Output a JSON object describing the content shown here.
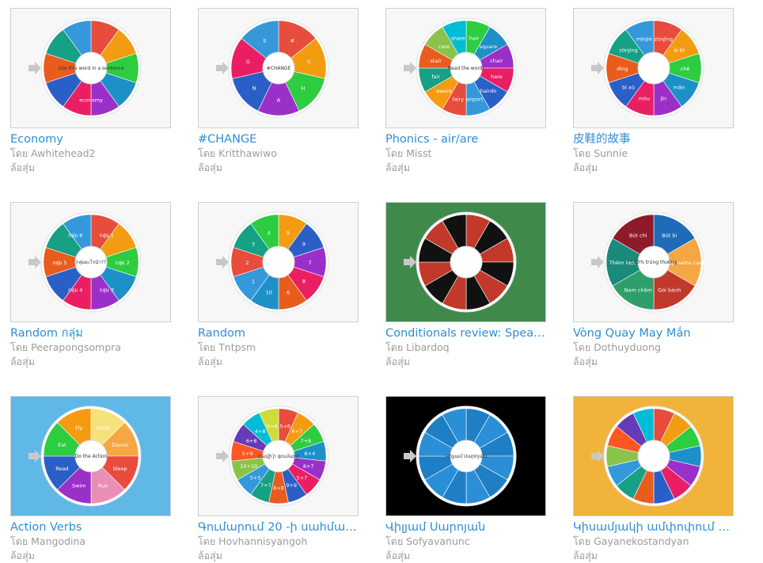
{
  "by_label": "โดย",
  "type_label": "ล้อสุ่ม",
  "activities": [
    {
      "title": "Economy",
      "author": "Awhitehead2",
      "center_text": "Use this word in a sentence",
      "segment_labels": [
        "economy"
      ],
      "background": "#f7f7f7",
      "colors": [
        "#e74c3c",
        "#f39c12",
        "#2ecc40",
        "#1e90c8",
        "#9b30c8",
        "#e91e63",
        "#2b5fc8",
        "#e85c1e",
        "#16a085",
        "#3498db"
      ]
    },
    {
      "title": "#CHANGE",
      "author": "Kritthawiwo",
      "center_text": "#CHANGE",
      "segment_labels": [
        "#",
        "C",
        "H",
        "A",
        "N",
        "G",
        "E"
      ],
      "background": "#f7f7f7",
      "colors": [
        "#e74c3c",
        "#f39c12",
        "#2ecc40",
        "#9b30c8",
        "#2b5fc8",
        "#e91e63",
        "#3498db"
      ]
    },
    {
      "title": "Phonics - air/are",
      "author": "Misst",
      "center_text": "Read the word!",
      "segment_labels": [
        "hair",
        "square",
        "chair",
        "hare",
        "hairdo",
        "airport",
        "fairy",
        "aware",
        "fair",
        "stair",
        "care",
        "share"
      ],
      "background": "#f7f7f7",
      "colors": [
        "#2ecc40",
        "#1e90c8",
        "#9b30c8",
        "#e91e63",
        "#2b5fc8",
        "#3498db",
        "#e74c3c",
        "#f39c12",
        "#16a085",
        "#e85c1e",
        "#8bc34a",
        "#00bcd4"
      ]
    },
    {
      "title": "皮鞋的故事",
      "author": "Sunnie",
      "center_text": "",
      "segment_labels": [
        "zūnjìng",
        "ài bì",
        "chē",
        "mǎn",
        "jīn",
        "mǒu",
        "bì xū",
        "dìng",
        "zūnjìng",
        "mǐnjié"
      ],
      "background": "#f7f7f7",
      "colors": [
        "#e74c3c",
        "#f39c12",
        "#2ecc40",
        "#1e90c8",
        "#9b30c8",
        "#e91e63",
        "#2b5fc8",
        "#e85c1e",
        "#16a085",
        "#3498db"
      ]
    },
    {
      "title": "Random กลุ่ม",
      "author": "Peerapongsompra",
      "center_text": "กลุ่มอะไรน้า??",
      "segment_labels": [
        "กลุ่ม 1",
        "กลุ่ม 2",
        "กลุ่ม 3",
        "กลุ่ม 4",
        "กลุ่ม 5",
        "กลุ่ม 6"
      ],
      "background": "#f7f7f7",
      "colors": [
        "#e74c3c",
        "#f39c12",
        "#2ecc40",
        "#1e90c8",
        "#9b30c8",
        "#e91e63",
        "#2b5fc8",
        "#e85c1e",
        "#16a085",
        "#3498db"
      ]
    },
    {
      "title": "Random",
      "author": "Tntpsm",
      "center_text": "",
      "segment_labels": [
        "5",
        "9",
        "7",
        "8",
        "6",
        "10",
        "1",
        "2",
        "3",
        "4"
      ],
      "background": "#f7f7f7",
      "colors": [
        "#f39c12",
        "#2b5fc8",
        "#9b30c8",
        "#e91e63",
        "#e85c1e",
        "#1e90c8",
        "#3498db",
        "#e74c3c",
        "#16a085",
        "#2ecc40"
      ]
    },
    {
      "title": "Conditionals review: Speak...",
      "author": "Libardoq",
      "center_text": "",
      "segment_labels": [],
      "background": "#3f8a4a",
      "colors": [
        "#c0392b",
        "#111111",
        "#c0392b",
        "#111111",
        "#c0392b",
        "#111111",
        "#c0392b",
        "#111111",
        "#c0392b",
        "#111111",
        "#c0392b",
        "#111111"
      ]
    },
    {
      "title": "Vòng Quay May Mắn",
      "author": "Dothuyduong",
      "center_text": "100% trúng thưởng",
      "segment_labels": [
        "Bút bi",
        "Tập name card",
        "Gói bánh",
        "Nam châm",
        "Thêm lượt",
        "Bút chì"
      ],
      "background": "#f7f7f7",
      "colors": [
        "#1e6bb8",
        "#f4a742",
        "#c0392b",
        "#2e9e6b",
        "#1a8a7a",
        "#8e1a2a"
      ]
    },
    {
      "title": "Action Verbs",
      "author": "Mangodina",
      "center_text": "Do the Action",
      "segment_labels": [
        "Jump",
        "Dance",
        "Sleep",
        "Run",
        "Swim",
        "Read",
        "Eat",
        "Fly"
      ],
      "background": "#5fb8e6",
      "colors": [
        "#f6e27a",
        "#f4a742",
        "#e74c3c",
        "#e88fb6",
        "#9b30c8",
        "#2b5fc8",
        "#2ecc40",
        "#f39c12"
      ]
    },
    {
      "title": "Գումարում 20 -ի սահման...",
      "author": "Hovhannisyangoh",
      "center_text": "Հավի՛ր գումարը",
      "segment_labels": [
        "5+6",
        "6+7",
        "7+8",
        "6+4",
        "8+7",
        "5+7",
        "9+9",
        "8+8",
        "7+7",
        "5+5",
        "10+10",
        "5+9",
        "6+8",
        "4+8",
        "9+6"
      ],
      "background": "#f7f7f7",
      "colors": [
        "#e74c3c",
        "#f39c12",
        "#2ecc40",
        "#1e90c8",
        "#9b30c8",
        "#e91e63",
        "#2b5fc8",
        "#e85c1e",
        "#16a085",
        "#3498db",
        "#8bc34a",
        "#ff5722",
        "#673ab7",
        "#00bcd4",
        "#cddc39"
      ]
    },
    {
      "title": "Վիլյամ Սարոյան",
      "author": "Sofyavanunc",
      "center_text": "Վիլյամ Սարոյան",
      "segment_labels": [],
      "background": "#000000",
      "colors": [
        "#1f7fc4",
        "#2a8fd6",
        "#1f7fc4",
        "#2a8fd6",
        "#1f7fc4",
        "#2a8fd6",
        "#1f7fc4",
        "#2a8fd6",
        "#1f7fc4",
        "#2a8fd6",
        "#1f7fc4",
        "#2a8fd6"
      ]
    },
    {
      "title": "Կիսամյակի ամփոփում 6-...",
      "author": "Gayanekostandyan",
      "center_text": "",
      "segment_labels": [],
      "background": "#f2b33a",
      "colors": [
        "#e74c3c",
        "#f39c12",
        "#2ecc40",
        "#1e90c8",
        "#9b30c8",
        "#e91e63",
        "#2b5fc8",
        "#e85c1e",
        "#16a085",
        "#3498db",
        "#8bc34a",
        "#ff5722",
        "#673ab7",
        "#00bcd4"
      ]
    }
  ]
}
